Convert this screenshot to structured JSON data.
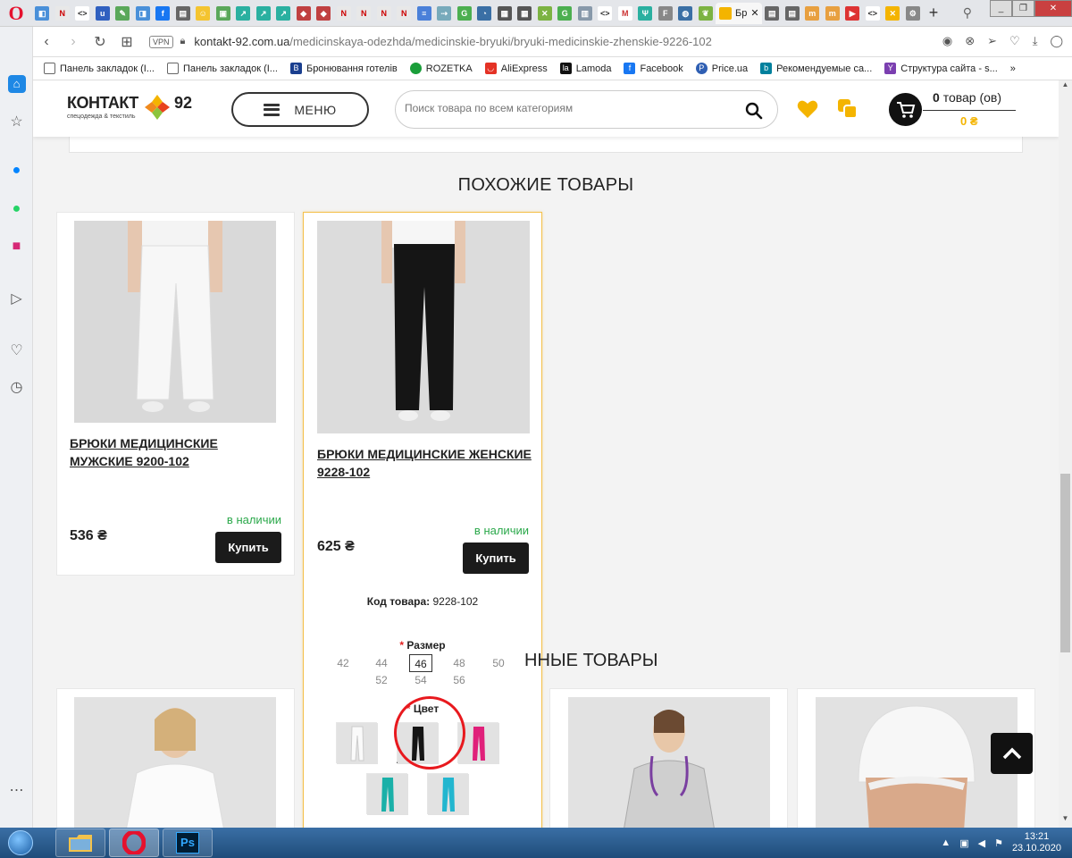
{
  "browser": {
    "active_tab_title": "Бр",
    "address": {
      "host": "kontakt-92.com.ua",
      "path": "/medicinskaya-odezhda/medicinskie-bryuki/bryuki-medicinskie-zhenskie-9226-102",
      "vpn_label": "VPN"
    },
    "bookmarks": [
      "Панель закладок (І...",
      "Панель закладок (І...",
      "Бронювання готелів",
      "ROZETKA",
      "AliExpress",
      "Lamoda",
      "Facebook",
      "Price.ua",
      "Рекомендуемые са...",
      "Структура сайта - s..."
    ],
    "bookmarks_more": "»"
  },
  "header": {
    "logo_name": "КОНТАКТ",
    "logo_number": "92",
    "logo_tagline": "спецодежда & текстиль",
    "menu_label": "МЕНЮ",
    "search_placeholder": "Поиск товара по всем категориям",
    "cart_count_number": "0",
    "cart_count_suffix": "товар (ов)",
    "cart_total": "0 ₴"
  },
  "sections": {
    "similar_title": "ПОХОЖИЕ ТОВАРЫ",
    "recent_title_fragment": "ННЫЕ ТОВАРЫ"
  },
  "products": [
    {
      "name": "БРЮКИ МЕДИЦИНСКИЕ МУЖСКИЕ 9200-102",
      "stock": "в наличии",
      "price": "536 ₴",
      "buy_label": "Купить"
    },
    {
      "name": "БРЮКИ МЕДИЦИНСКИЕ ЖЕНСКИЕ 9228-102",
      "stock": "в наличии",
      "price": "625 ₴",
      "buy_label": "Купить",
      "code_label": "Код товара:",
      "code_value": "9228-102",
      "size_label": "Размер",
      "sizes_row1": [
        "42",
        "44",
        "46",
        "48",
        "50"
      ],
      "sizes_row2": [
        "52",
        "54",
        "56"
      ],
      "selected_size": "46",
      "color_label": "Цвет",
      "colors": [
        "white",
        "black",
        "pink",
        "teal",
        "turquoise"
      ],
      "selected_color": "black"
    }
  ],
  "required_mark": "*",
  "taskbar": {
    "time": "13:21",
    "date": "23.10.2020",
    "apps": [
      "explorer",
      "opera",
      "photoshop"
    ],
    "ps_label": "Ps"
  },
  "colors": {
    "accent_yellow": "#f4b400",
    "in_stock_green": "#2aa84a",
    "annotation_red": "#e8191e",
    "button_dark": "#1b1b1b"
  }
}
